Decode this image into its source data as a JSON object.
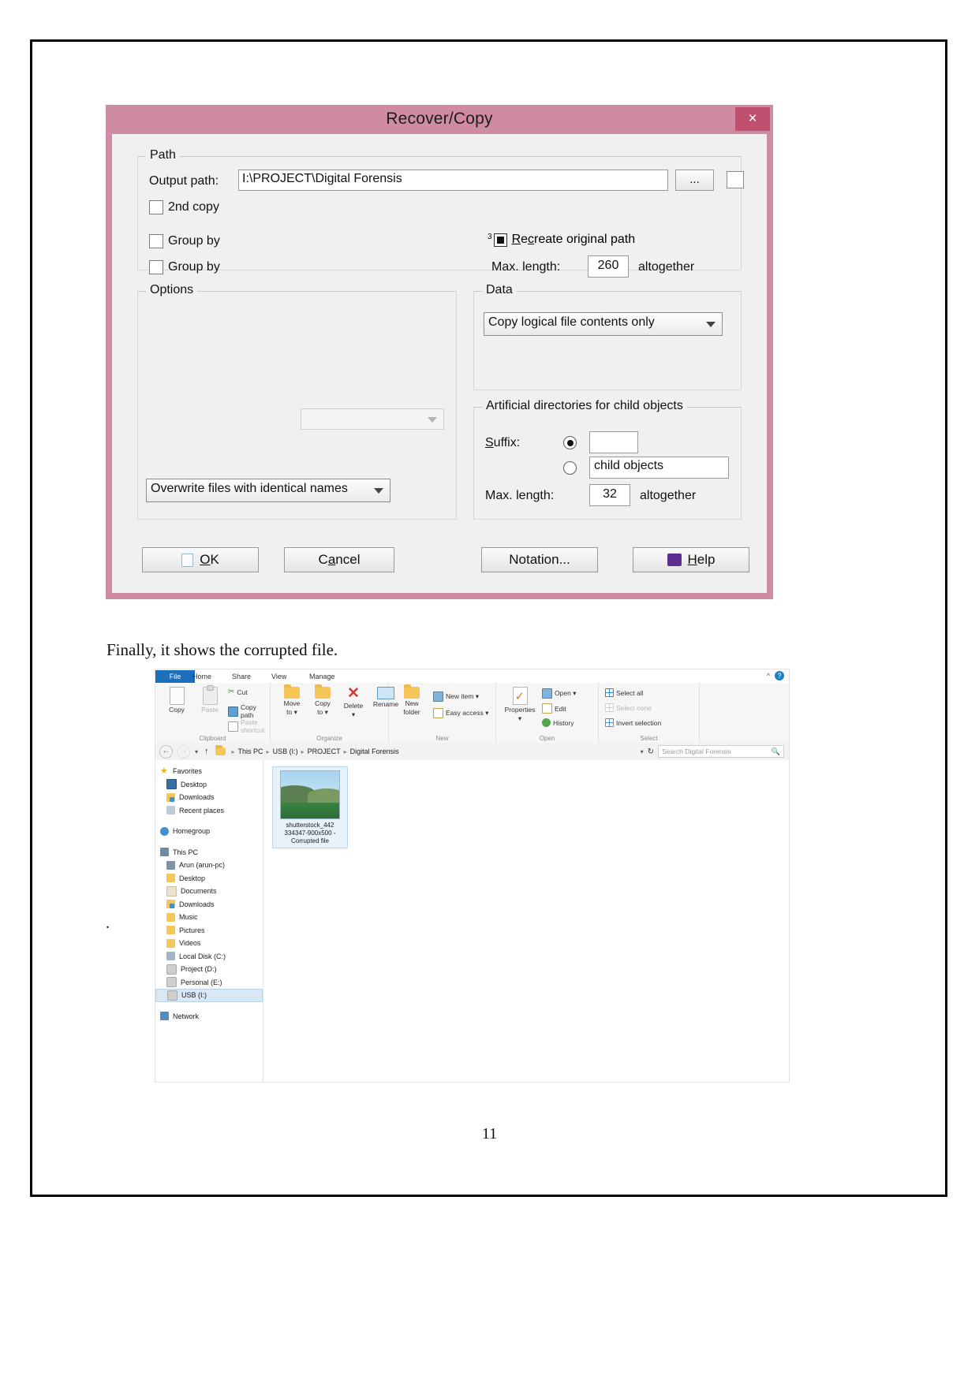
{
  "document": {
    "paragraph": "Finally, it shows the corrupted file.",
    "page_number": "11",
    "stray_mark": "."
  },
  "dialog": {
    "title": "Recover/Copy",
    "close_label": "×",
    "path_group": {
      "legend": "Path",
      "output_path_label": "Output path:",
      "output_path_value": "I:\\PROJECT\\Digital Forensis",
      "browse_label": "...",
      "second_copy_label": "2nd copy",
      "group_by_1_label": "Group by",
      "group_by_2_label": "Group by",
      "recreate_superscript": "3",
      "recreate_label": "Recreate original path",
      "max_length_label": "Max. length:",
      "max_length_value": "260",
      "max_length_suffix": "altogether"
    },
    "options_group": {
      "legend": "Options",
      "overwrite_value": "Overwrite files with identical names"
    },
    "data_group": {
      "legend": "Data",
      "copy_mode_value": "Copy logical file contents only"
    },
    "artificial_group": {
      "legend": "Artificial directories for child objects",
      "suffix_label": "Suffix:",
      "suffix_value": "",
      "child_objects_value": "child objects",
      "max_length_label": "Max. length:",
      "max_length_value": "32",
      "max_length_suffix": "altogether"
    },
    "buttons": {
      "ok": "OK",
      "cancel": "Cancel",
      "notation": "Notation...",
      "help": "Help"
    },
    "colors": {
      "titlebar": "#cf8ba4",
      "close": "#c0506f",
      "face": "#f0f0f0"
    }
  },
  "explorer": {
    "tabs": [
      {
        "label": "File",
        "active": true
      },
      {
        "label": "Home",
        "active": false
      },
      {
        "label": "Share",
        "active": false
      },
      {
        "label": "View",
        "active": false
      },
      {
        "label": "Manage",
        "active": false
      }
    ],
    "help_glyph": "?",
    "collapse_glyph": "^",
    "ribbon": {
      "clipboard": {
        "label": "Clipboard",
        "copy": "Copy",
        "paste": "Paste",
        "cut": "Cut",
        "copy_path": "Copy path",
        "paste_shortcut": "Paste shortcut"
      },
      "organize": {
        "label": "Organize",
        "move_to": "Move\nto",
        "move_to_line1": "Move",
        "move_to_line2": "to",
        "copy_to_line1": "Copy",
        "copy_to_line2": "to",
        "delete": "Delete",
        "rename": "Rename"
      },
      "new": {
        "label": "New",
        "new_folder_line1": "New",
        "new_folder_line2": "folder",
        "new_item": "New item",
        "easy_access": "Easy access"
      },
      "open": {
        "label": "Open",
        "properties": "Properties",
        "open": "Open",
        "edit": "Edit",
        "history": "History"
      },
      "select": {
        "label": "Select",
        "select_all": "Select all",
        "select_none": "Select none",
        "invert_selection": "Invert selection"
      }
    },
    "address": {
      "back": "←",
      "forward": "→",
      "breadcrumbs": [
        "This PC",
        "USB (I:)",
        "PROJECT",
        "Digital Forensis"
      ],
      "refresh": "↻",
      "search_placeholder": "Search Digital Forensis"
    },
    "nav_pane": [
      {
        "label": "Favorites",
        "icon": "star-icon",
        "level": 0
      },
      {
        "label": "Desktop",
        "icon": "desktop-icon",
        "level": 1
      },
      {
        "label": "Downloads",
        "icon": "downloads-icon",
        "level": 1
      },
      {
        "label": "Recent places",
        "icon": "recent-places-icon",
        "level": 1
      },
      {
        "label": "Homegroup",
        "icon": "homegroup-icon",
        "level": 0,
        "gap_before": true
      },
      {
        "label": "This PC",
        "icon": "this-pc-icon",
        "level": 0,
        "gap_before": true
      },
      {
        "label": "Arun (arun-pc)",
        "icon": "user-icon",
        "level": 1
      },
      {
        "label": "Desktop",
        "icon": "folder-icon",
        "level": 1
      },
      {
        "label": "Documents",
        "icon": "documents-icon",
        "level": 1
      },
      {
        "label": "Downloads",
        "icon": "downloads-icon",
        "level": 1
      },
      {
        "label": "Music",
        "icon": "folder-icon",
        "level": 1
      },
      {
        "label": "Pictures",
        "icon": "folder-icon",
        "level": 1
      },
      {
        "label": "Videos",
        "icon": "folder-icon",
        "level": 1
      },
      {
        "label": "Local Disk (C:)",
        "icon": "disk-icon",
        "level": 1
      },
      {
        "label": "Project (D:)",
        "icon": "drive-icon",
        "level": 1
      },
      {
        "label": "Personal (E:)",
        "icon": "drive-icon",
        "level": 1
      },
      {
        "label": "USB (I:)",
        "icon": "drive-icon",
        "level": 1,
        "selected": true
      },
      {
        "label": "Network",
        "icon": "network-icon",
        "level": 0,
        "gap_before": true
      }
    ],
    "file": {
      "name_line1": "shutterstock_442",
      "name_line2": "334347-900x500 -",
      "name_line3": "Corrupted file"
    }
  }
}
